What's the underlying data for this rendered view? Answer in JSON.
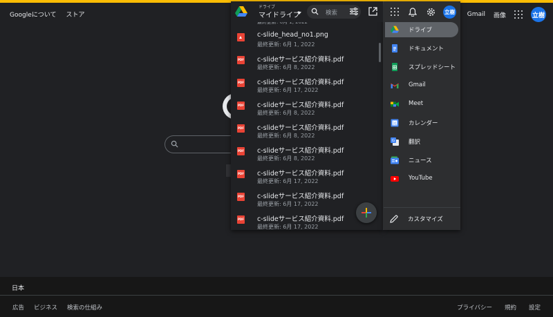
{
  "google": {
    "top_left": [
      "Googleについて",
      "ストア"
    ],
    "top_right": {
      "gmail": "Gmail",
      "images": "画像",
      "avatar": "立樹"
    }
  },
  "footer": {
    "country": "日本",
    "left_links": [
      "広告",
      "ビジネス",
      "検索の仕組み"
    ],
    "right_links": [
      "プライバシー",
      "規約",
      "設定"
    ]
  },
  "drive": {
    "subtitle": "ドライブ",
    "title": "マイドライブ",
    "search_placeholder": "検索",
    "partial_date": "最終更新: 6月 1, 2022",
    "files": [
      {
        "name": "c-slide_head_no1.png",
        "date": "最終更新: 6月 1, 2022",
        "type": "image"
      },
      {
        "name": "c-slideサービス紹介資料.pdf",
        "date": "最終更新: 6月 8, 2022",
        "type": "pdf"
      },
      {
        "name": "c-slideサービス紹介資料.pdf",
        "date": "最終更新: 6月 17, 2022",
        "type": "pdf"
      },
      {
        "name": "c-slideサービス紹介資料.pdf",
        "date": "最終更新: 6月 8, 2022",
        "type": "pdf"
      },
      {
        "name": "c-slideサービス紹介資料.pdf",
        "date": "最終更新: 6月 8, 2022",
        "type": "pdf"
      },
      {
        "name": "c-slideサービス紹介資料.pdf",
        "date": "最終更新: 6月 8, 2022",
        "type": "pdf"
      },
      {
        "name": "c-slideサービス紹介資料.pdf",
        "date": "最終更新: 6月 17, 2022",
        "type": "pdf"
      },
      {
        "name": "c-slideサービス紹介資料.pdf",
        "date": "最終更新: 6月 17, 2022",
        "type": "pdf"
      },
      {
        "name": "c-slideサービス紹介資料.pdf",
        "date": "最終更新: 6月 17, 2022",
        "type": "pdf"
      }
    ],
    "pdf_badge": "PDF"
  },
  "apps_panel": {
    "avatar": "立樹",
    "items": [
      {
        "label": "ドライブ",
        "icon": "drive-icon",
        "active": true
      },
      {
        "label": "ドキュメント",
        "icon": "docs-icon"
      },
      {
        "label": "スプレッドシート",
        "icon": "sheets-icon"
      },
      {
        "label": "Gmail",
        "icon": "gmail-icon"
      },
      {
        "label": "Meet",
        "icon": "meet-icon"
      },
      {
        "label": "カレンダー",
        "icon": "calendar-icon"
      },
      {
        "label": "翻訳",
        "icon": "translate-icon"
      },
      {
        "label": "ニュース",
        "icon": "news-icon"
      },
      {
        "label": "YouTube",
        "icon": "youtube-icon"
      }
    ],
    "customize": "カスタマイズ"
  },
  "colors": {
    "background": "#202124",
    "accent_yellow": "#fbbc04",
    "avatar_blue": "#1a73e8"
  }
}
